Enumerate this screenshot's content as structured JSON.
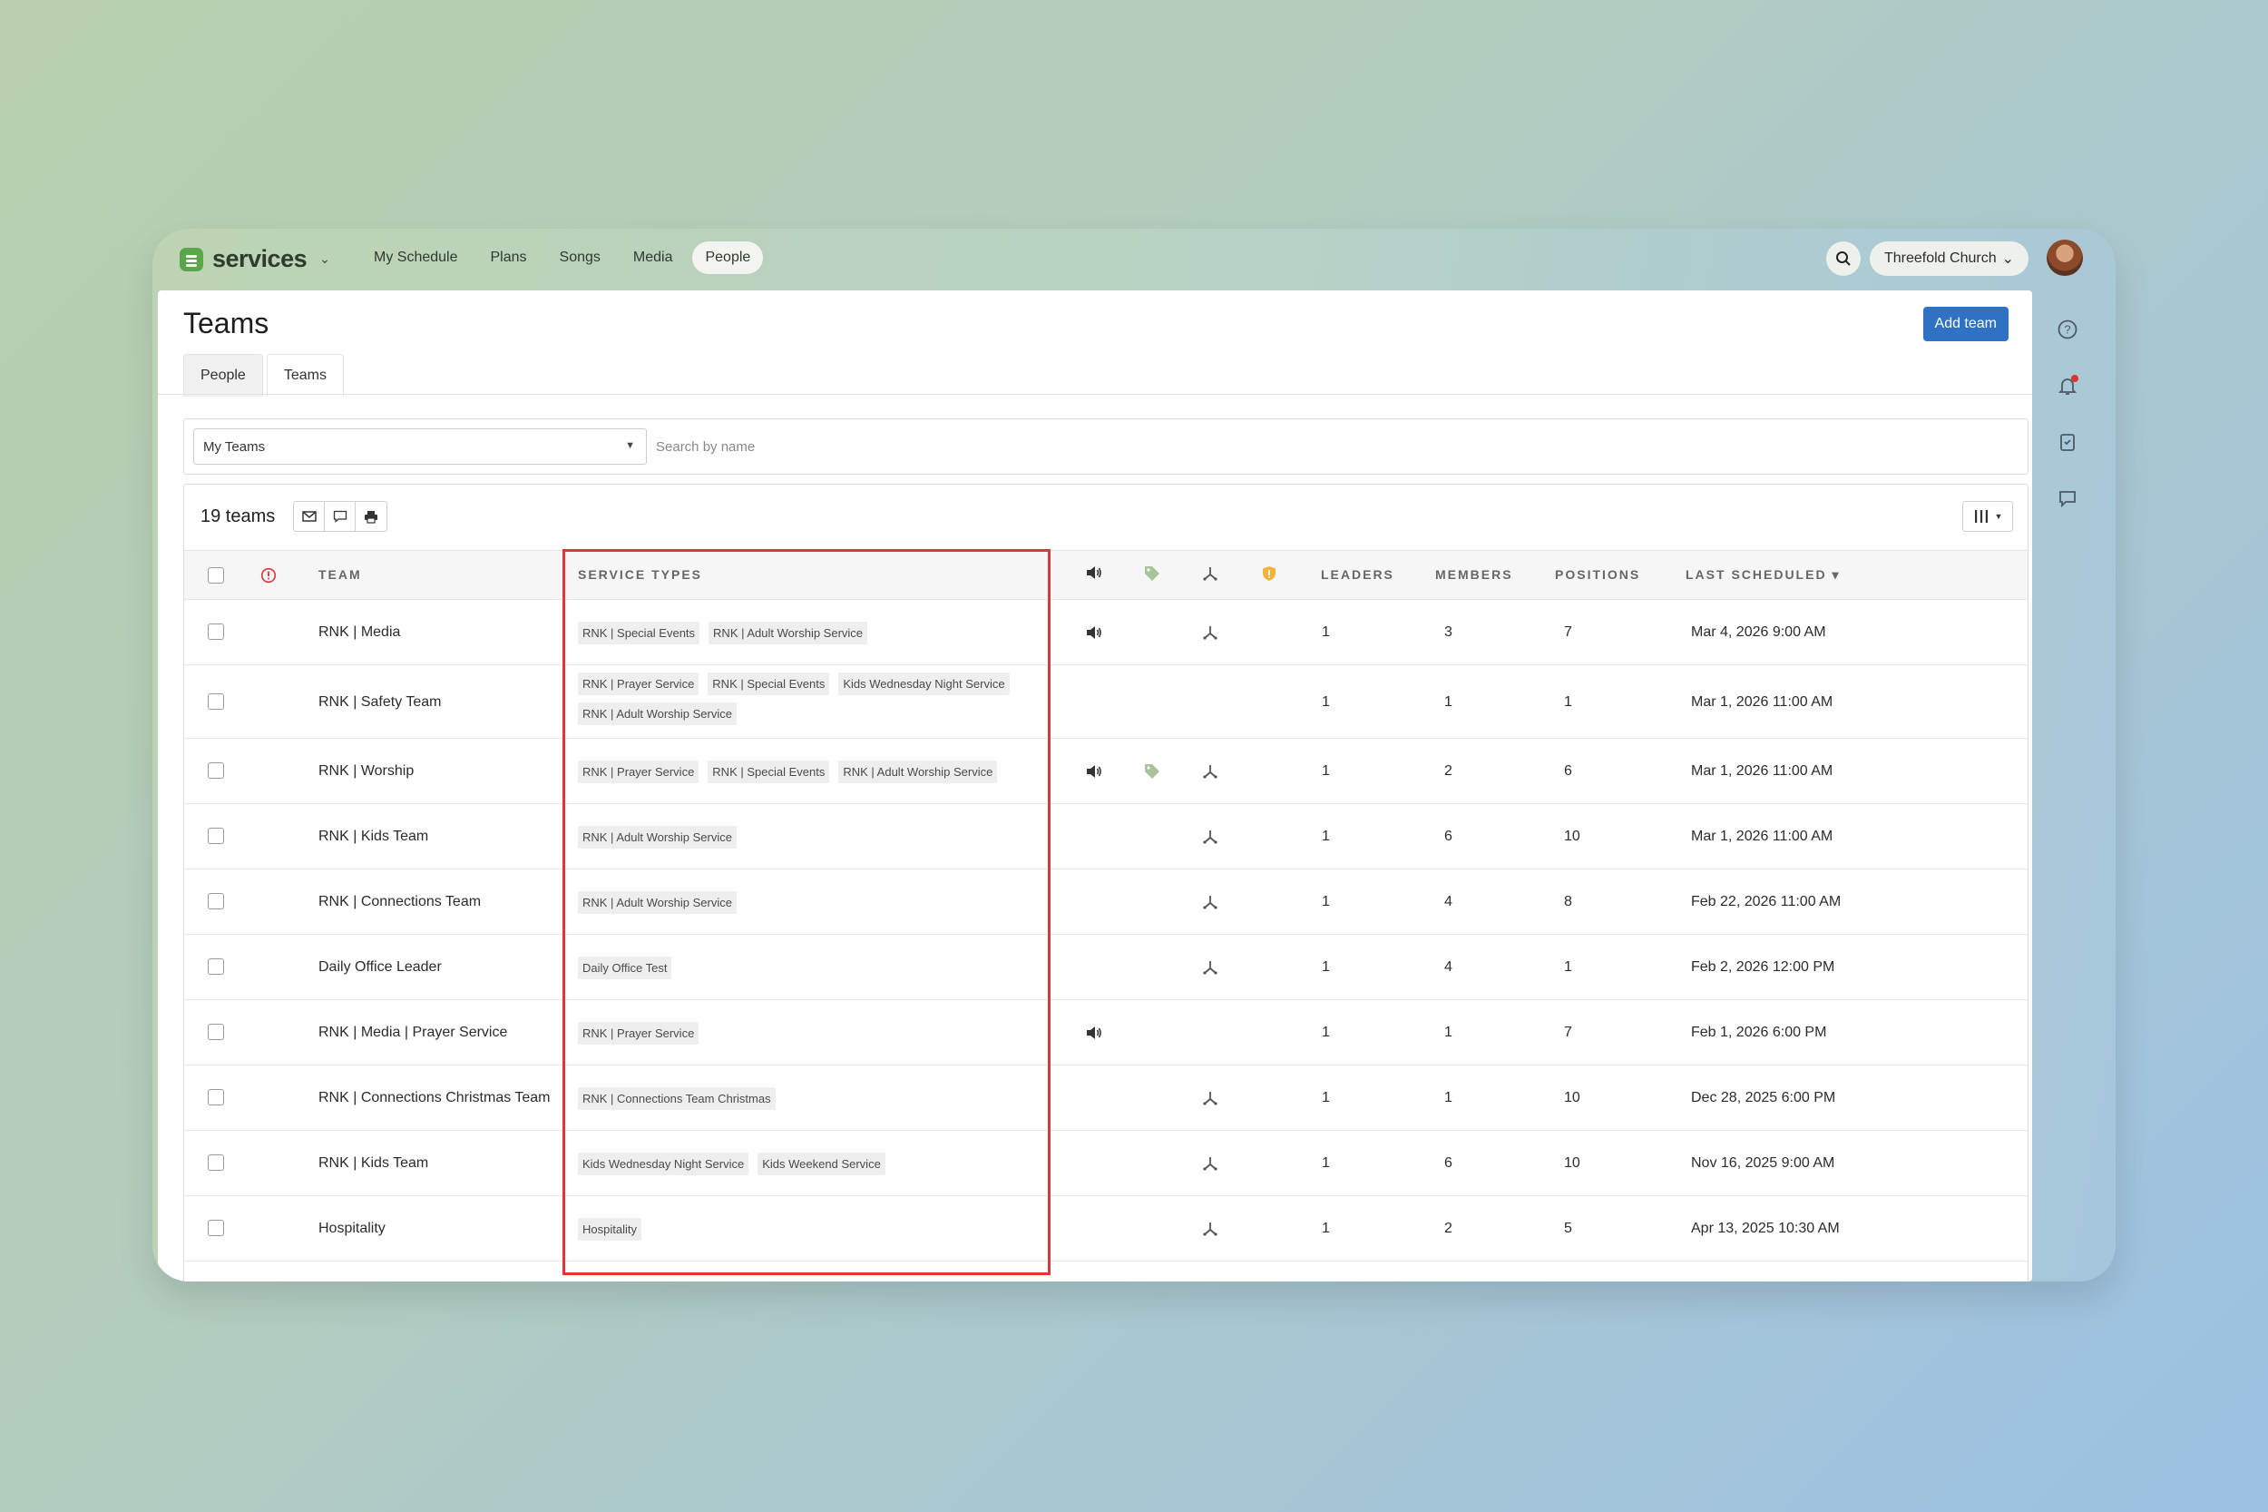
{
  "app": {
    "brand": "services",
    "nav": [
      "My Schedule",
      "Plans",
      "Songs",
      "Media",
      "People"
    ],
    "active_nav": "People",
    "org": "Threefold Church"
  },
  "page": {
    "title": "Teams",
    "add_button": "Add team",
    "tabs": [
      "People",
      "Teams"
    ],
    "active_tab": "Teams"
  },
  "filter": {
    "select_value": "My Teams",
    "search_placeholder": "Search by name"
  },
  "table": {
    "count_label": "19 teams",
    "headers": {
      "team": "TEAM",
      "service_types": "SERVICE TYPES",
      "leaders": "LEADERS",
      "members": "MEMBERS",
      "positions": "POSITIONS",
      "last_scheduled": "LAST SCHEDULED ▾"
    },
    "rows": [
      {
        "team": "RNK | Media",
        "services": [
          "RNK | Special Events",
          "RNK | Adult Worship Service"
        ],
        "audio": true,
        "tag": false,
        "split": true,
        "leaders": "1",
        "members": "3",
        "positions": "7",
        "last": "Mar 4, 2026 9:00 AM"
      },
      {
        "team": "RNK | Safety Team",
        "services": [
          "RNK | Prayer Service",
          "RNK | Special Events",
          "Kids Wednesday Night Service",
          "RNK | Adult Worship Service"
        ],
        "audio": false,
        "tag": false,
        "split": false,
        "leaders": "1",
        "members": "1",
        "positions": "1",
        "last": "Mar 1, 2026 11:00 AM"
      },
      {
        "team": "RNK | Worship",
        "services": [
          "RNK | Prayer Service",
          "RNK | Special Events",
          "RNK | Adult Worship Service"
        ],
        "audio": true,
        "tag": true,
        "split": true,
        "leaders": "1",
        "members": "2",
        "positions": "6",
        "last": "Mar 1, 2026 11:00 AM"
      },
      {
        "team": "RNK | Kids Team",
        "services": [
          "RNK | Adult Worship Service"
        ],
        "audio": false,
        "tag": false,
        "split": true,
        "leaders": "1",
        "members": "6",
        "positions": "10",
        "last": "Mar 1, 2026 11:00 AM"
      },
      {
        "team": "RNK | Connections Team",
        "services": [
          "RNK | Adult Worship Service"
        ],
        "audio": false,
        "tag": false,
        "split": true,
        "leaders": "1",
        "members": "4",
        "positions": "8",
        "last": "Feb 22, 2026 11:00 AM"
      },
      {
        "team": "Daily Office Leader",
        "services": [
          "Daily Office Test"
        ],
        "audio": false,
        "tag": false,
        "split": true,
        "leaders": "1",
        "members": "4",
        "positions": "1",
        "last": "Feb 2, 2026 12:00 PM"
      },
      {
        "team": "RNK | Media | Prayer Service",
        "services": [
          "RNK | Prayer Service"
        ],
        "audio": true,
        "tag": false,
        "split": false,
        "leaders": "1",
        "members": "1",
        "positions": "7",
        "last": "Feb 1, 2026 6:00 PM"
      },
      {
        "team": "RNK | Connections Christmas Team",
        "services": [
          "RNK | Connections Team Christmas"
        ],
        "audio": false,
        "tag": false,
        "split": true,
        "leaders": "1",
        "members": "1",
        "positions": "10",
        "last": "Dec 28, 2025 6:00 PM"
      },
      {
        "team": "RNK | Kids Team",
        "services": [
          "Kids Wednesday Night Service",
          "Kids Weekend Service"
        ],
        "audio": false,
        "tag": false,
        "split": true,
        "leaders": "1",
        "members": "6",
        "positions": "10",
        "last": "Nov 16, 2025 9:00 AM"
      },
      {
        "team": "Hospitality",
        "services": [
          "Hospitality"
        ],
        "audio": false,
        "tag": false,
        "split": true,
        "leaders": "1",
        "members": "2",
        "positions": "5",
        "last": "Apr 13, 2025 10:30 AM"
      }
    ]
  },
  "colors": {
    "accent": "#2f72c4",
    "brand": "#5aa64a",
    "highlight": "#e2353a",
    "alert": "#e4312b",
    "shield": "#f0b43c",
    "tag": "#a8c39a"
  },
  "icons": [
    "search-icon",
    "chevron-down-icon",
    "help-icon",
    "bell-icon",
    "clipboard-check-icon",
    "chat-icon",
    "envelope-icon",
    "chat-bubble-icon",
    "printer-icon",
    "columns-icon",
    "alert-icon",
    "speaker-icon",
    "tag-icon",
    "split-icon",
    "shield-icon"
  ]
}
